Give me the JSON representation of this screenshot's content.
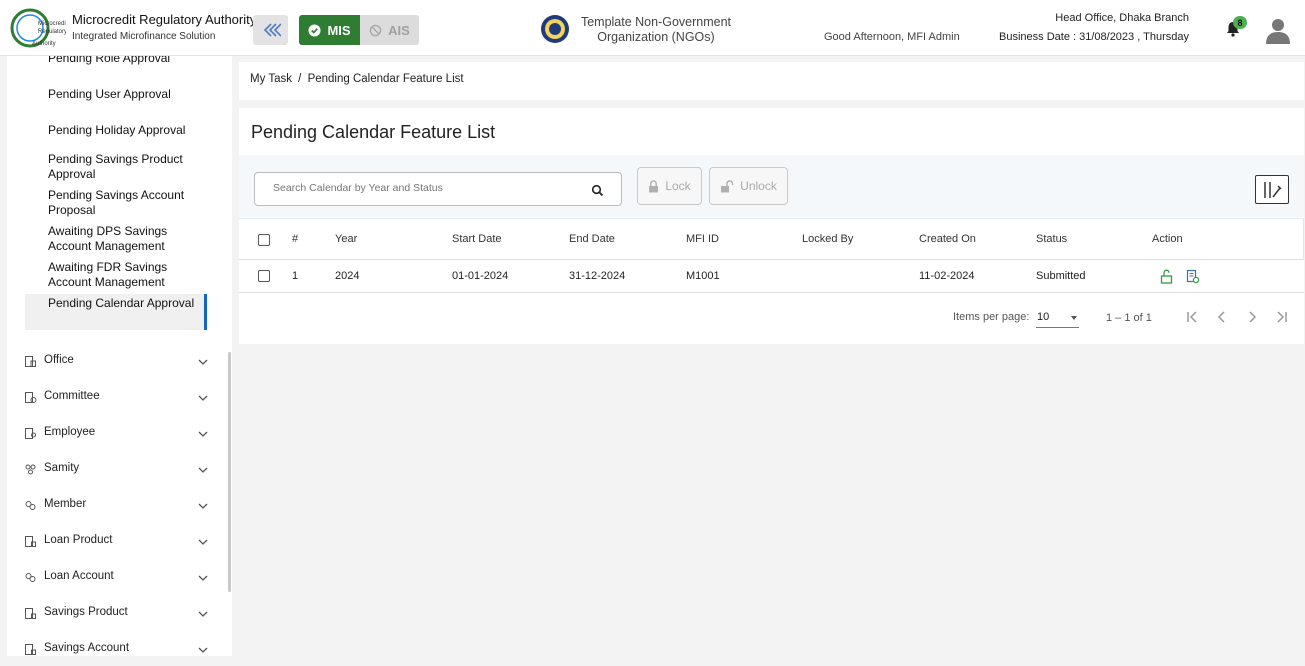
{
  "header": {
    "org_name": "Microcredit Regulatory Authority",
    "org_sub": "Integrated Microfinance Solution",
    "logo_text": "Microcredit Regulatory Authority",
    "mis_label": "MIS",
    "ais_label": "AIS",
    "tenant": "Template Non-Government Organization (NGOs)",
    "greeting": "Good Afternoon, MFI Admin",
    "branch": "Head Office, Dhaka Branch",
    "business_date": "Business Date : 31/08/2023 , Thursday",
    "notifications": "8",
    "colors": {
      "mis_green": "#2e7d32",
      "badge_green": "#4caf50",
      "accent_blue": "#1565c0"
    }
  },
  "sidebar": {
    "sub_items": [
      "Pending Role Approval",
      "Pending User Approval",
      "Pending Holiday Approval",
      "Pending Savings Product Approval",
      "Pending Savings Account Proposal",
      "Awaiting DPS Savings Account Management",
      "Awaiting FDR Savings Account Management",
      "Pending Calendar Approval"
    ],
    "menu_items": [
      {
        "label": "Office",
        "icon": "office-icon"
      },
      {
        "label": "Committee",
        "icon": "committee-icon"
      },
      {
        "label": "Employee",
        "icon": "employee-icon"
      },
      {
        "label": "Samity",
        "icon": "samity-icon"
      },
      {
        "label": "Member",
        "icon": "member-icon"
      },
      {
        "label": "Loan Product",
        "icon": "loan-product-icon"
      },
      {
        "label": "Loan Account",
        "icon": "loan-account-icon"
      },
      {
        "label": "Savings Product",
        "icon": "savings-product-icon"
      },
      {
        "label": "Savings Account",
        "icon": "savings-account-icon"
      }
    ]
  },
  "breadcrumb": {
    "root": "My Task",
    "sep": "/",
    "current": "Pending Calendar Feature List"
  },
  "page": {
    "title": "Pending Calendar Feature List",
    "search_placeholder": "Search Calendar by Year and Status",
    "lock_label": "Lock",
    "unlock_label": "Unlock"
  },
  "table": {
    "columns": [
      "#",
      "Year",
      "Start Date",
      "End Date",
      "MFI ID",
      "Locked By",
      "Created On",
      "Status",
      "Action"
    ],
    "rows": [
      {
        "num": "1",
        "year": "2024",
        "start": "01-01-2024",
        "end": "31-12-2024",
        "mfi": "M1001",
        "locked_by": "",
        "created": "11-02-2024",
        "status": "Submitted"
      }
    ]
  },
  "pagination": {
    "items_per_page_label": "Items per page:",
    "items_per_page": "10",
    "range": "1 – 1 of 1"
  }
}
